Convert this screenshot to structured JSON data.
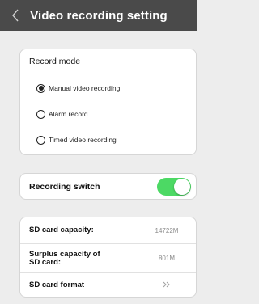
{
  "navbar": {
    "back_icon": "chevron-left-icon",
    "title": "Video recording setting"
  },
  "record_mode": {
    "header": "Record mode",
    "options": [
      {
        "label": "Manual video recording",
        "selected": true
      },
      {
        "label": "Alarm record",
        "selected": false
      },
      {
        "label": "Timed video recording",
        "selected": false
      }
    ]
  },
  "recording_switch": {
    "label": "Recording switch",
    "on": true,
    "color": "#4cd964"
  },
  "sd_card": {
    "capacity_label": "SD card capacity:",
    "capacity_value": "14722M",
    "surplus_label_line1": "Surplus capacity of",
    "surplus_label_line2": "SD card:",
    "surplus_value": "801M",
    "format_label": "SD card format",
    "format_icon": "double-chevron-right-icon"
  },
  "colors": {
    "navbar": "#4a4a4a",
    "background": "#ededed",
    "toggle_on": "#4cd964"
  }
}
